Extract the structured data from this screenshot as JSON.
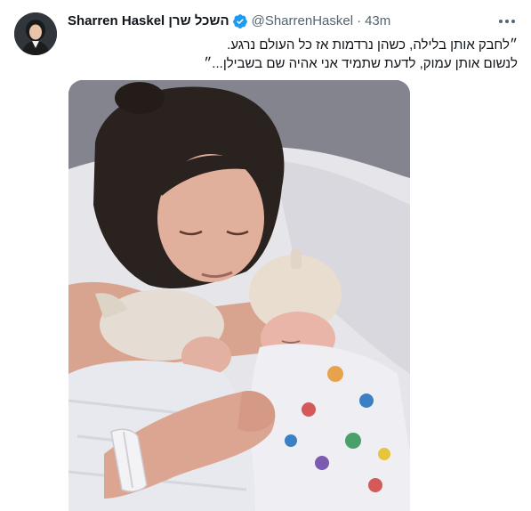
{
  "tweet": {
    "author_name": "Sharren Haskel השכל שרן",
    "handle": "@SharrenHaskel",
    "separator": "·",
    "time": "43m",
    "text_line1": "״לחבק אותן בלילה, כשהן נרדמות אז כל העולם נרגע.",
    "text_line2": "לנשום אותן עמוק, לדעת שתמיד אני אהיה שם בשבילן...״"
  },
  "icons": {
    "verified": "verified-badge-icon",
    "more": "more-options-icon"
  },
  "colors": {
    "verified": "#1d9bf0",
    "secondary_text": "#536471",
    "primary_text": "#0f1419"
  }
}
